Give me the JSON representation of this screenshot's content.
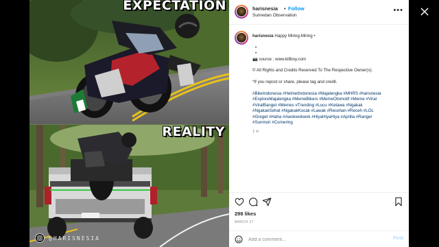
{
  "photo": {
    "caption_top": "EXPECTATION",
    "caption_bottom": "REALITY",
    "watermark": "@HARISNESIA"
  },
  "header": {
    "username": "harisnesia",
    "separator": "•",
    "follow_label": "Follow",
    "location": "Sumedan Observation",
    "more_icon": "more-horizontal-icon"
  },
  "caption": {
    "username": "harisnesia",
    "text": "Happy Miring-Miring •",
    "dot1": "•",
    "dot2": "•",
    "source": "📷 source : www.killboy.com",
    "rights": "© All Rights and Credits Reserved To The Respective Owner(s).",
    "repost": "*If you repost or share, please tag and credit.",
    "hashtag_lines": [
      "#BikeIndonesia #HelmetIndonesia #Majalengka #MHRS #harisnesia",
      "#ExploreMajalengka #MemeBikers #MemeOtomotif #Meme #Viral",
      "#ViralBanget #Memes #Trending #Lucu #Ketawa #Ngakak",
      "#NgakakSehat #NgakakKocak #Lawak #Recehan #Receh #LOL",
      "#Greget #Haha #Awokwokwok #HiyaHiyaHiya #Aprilia #Ranger",
      "#Sunmori #Cornering"
    ],
    "time": "1 w"
  },
  "actions": {
    "like_icon": "heart-icon",
    "comment_icon": "comment-icon",
    "share_icon": "paper-plane-icon",
    "save_icon": "bookmark-icon"
  },
  "likes": "298 likes",
  "date": "MARCH 27",
  "comment": {
    "placeholder": "Add a comment...",
    "post_label": "Post"
  },
  "colors": {
    "link": "#0095f6",
    "hashtag": "#00376b",
    "muted": "#8e8e8e"
  }
}
